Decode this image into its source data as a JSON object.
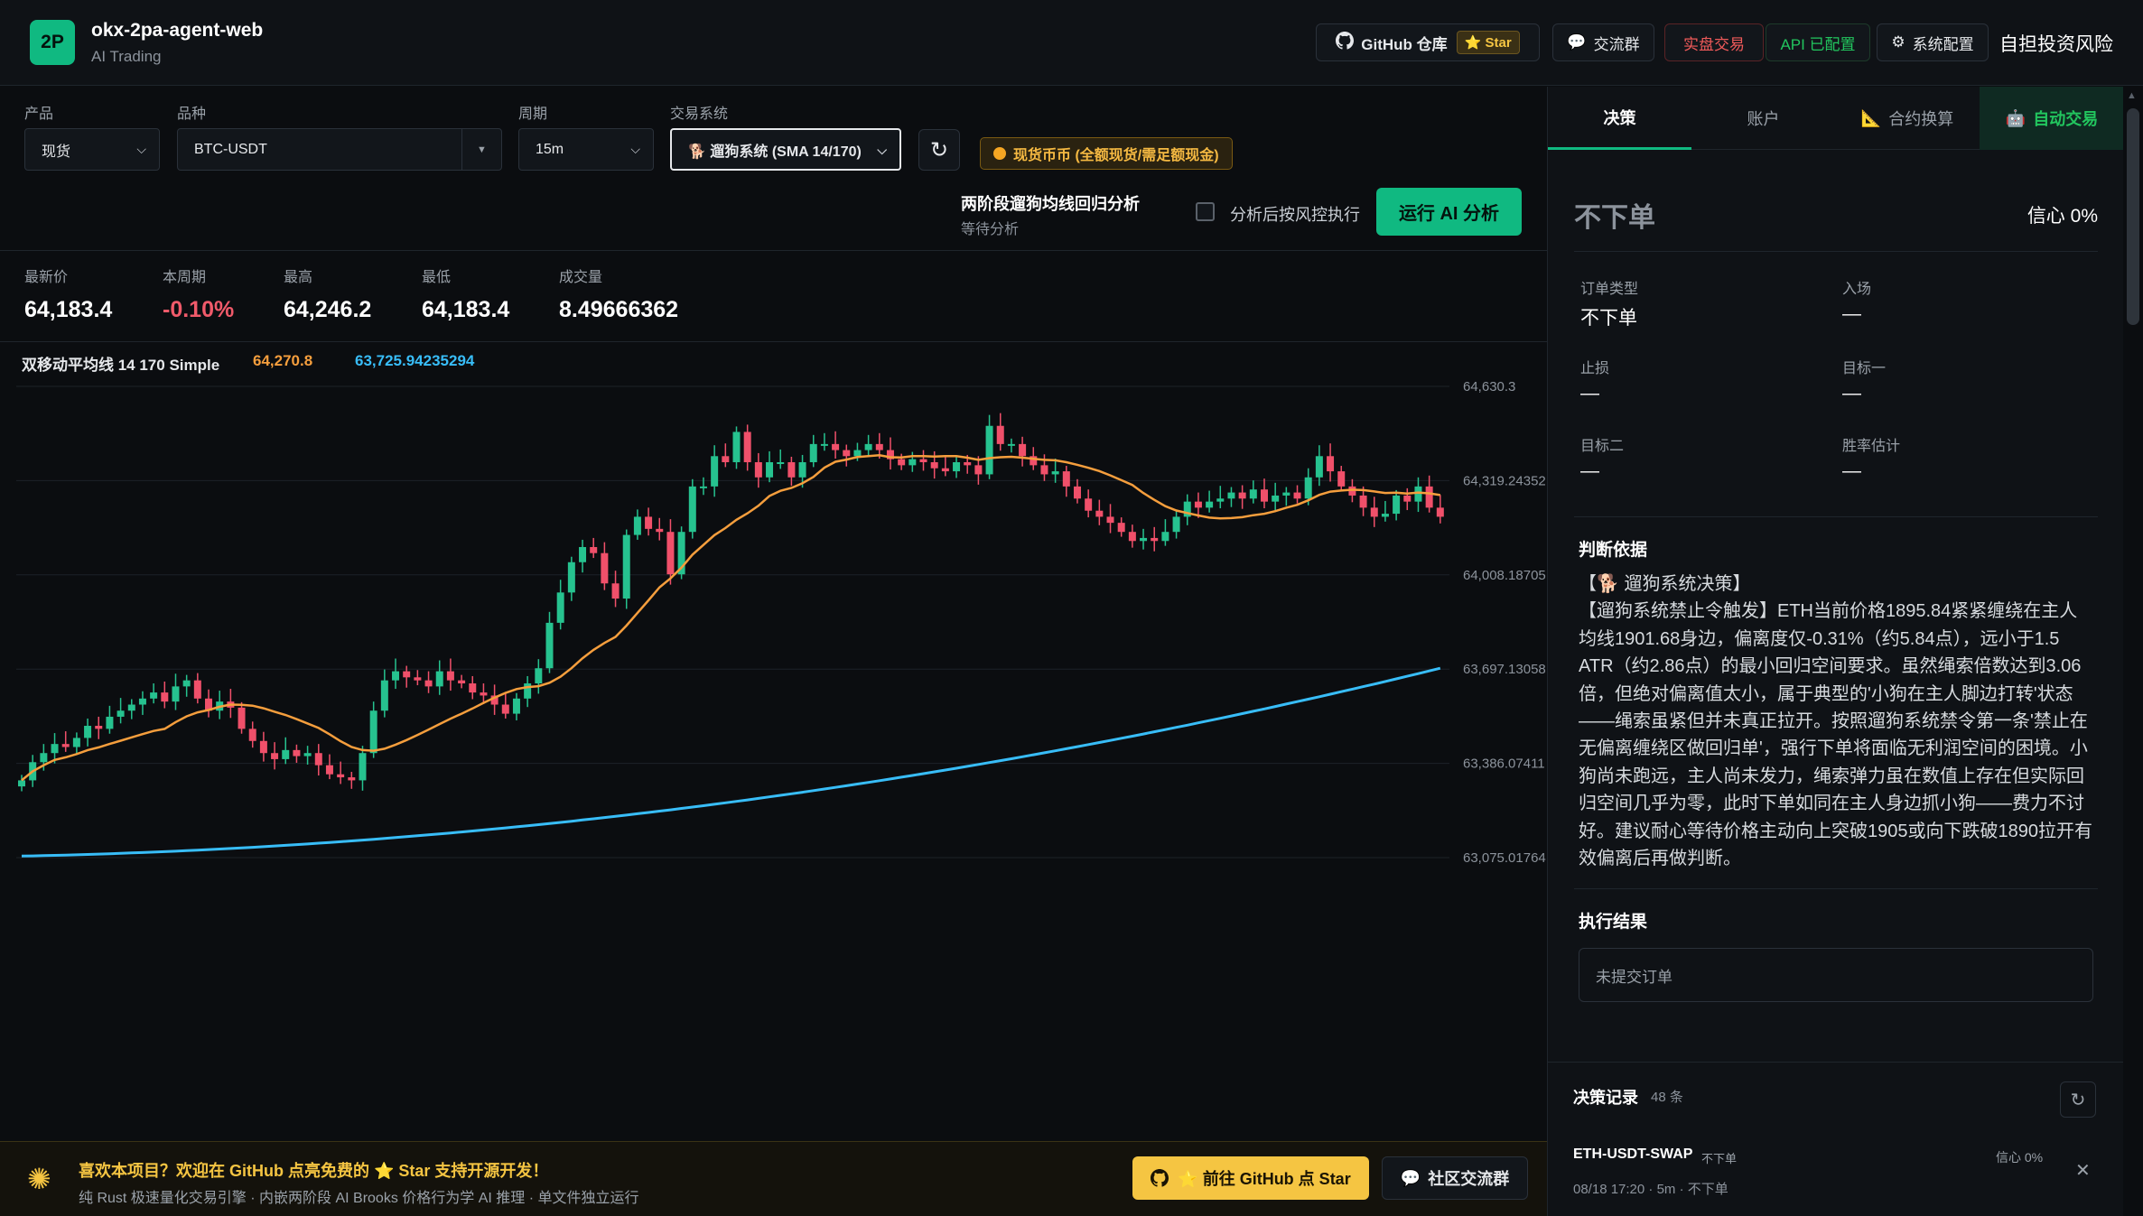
{
  "header": {
    "logo": "2P",
    "title": "okx-2pa-agent-web",
    "subtitle": "AI Trading",
    "github_label": "GitHub 仓库",
    "star_label": "Star",
    "chat_label": "交流群",
    "live_label": "实盘交易",
    "api_label": "API 已配置",
    "settings_label": "系统配置",
    "risk_notice": "自担投资风险"
  },
  "controls": {
    "product_label": "产品",
    "product_value": "现货",
    "symbol_label": "品种",
    "symbol_value": "BTC-USDT",
    "period_label": "周期",
    "period_value": "15m",
    "system_label": "交易系统",
    "system_value": "🐕 遛狗系统 (SMA 14/170)",
    "spot_badge": "现货币币 (全额现货/需足额现金)",
    "analysis_title": "两阶段遛狗均线回归分析",
    "analysis_status": "等待分析",
    "risk_exec_label": "分析后按风控执行",
    "run_button": "运行 AI 分析"
  },
  "stats": {
    "last_label": "最新价",
    "last_value": "64,183.4",
    "period_label": "本周期",
    "period_value": "-0.10%",
    "high_label": "最高",
    "high_value": "64,246.2",
    "low_label": "最低",
    "low_value": "64,183.4",
    "volume_label": "成交量",
    "volume_value": "8.49666362"
  },
  "chart_data": {
    "type": "candlestick",
    "indicator_name": "双移动平均线 14 170 Simple",
    "sma_fast_value": "64,270.8",
    "sma_slow_value": "63,725.94235294",
    "y_ticks": [
      "64,630.3",
      "64,319.24352",
      "64,008.18705",
      "63,697.13058",
      "63,386.07411",
      "63,075.01764"
    ],
    "ylim": [
      63075.02,
      64630.3
    ],
    "colors": {
      "up": "#26c28f",
      "down": "#f0506a",
      "sma_fast": "#f59e3d",
      "sma_slow": "#38bdf8"
    }
  },
  "banner": {
    "title": "喜欢本项目？欢迎在 GitHub 点亮免费的 ⭐ Star 支持开源开发！",
    "subtitle": "纯 Rust 极速量化交易引擎 · 内嵌两阶段 AI Brooks 价格行为学 AI 推理 · 单文件独立运行",
    "github_button": "⭐ 前往 GitHub 点 Star",
    "community_button": "社区交流群"
  },
  "panel": {
    "tabs": [
      "决策",
      "账户",
      "合约换算",
      "自动交易"
    ],
    "decision": "不下单",
    "confidence": "信心 0%",
    "fields": [
      {
        "label": "订单类型",
        "value": "不下单"
      },
      {
        "label": "入场",
        "value": "—"
      },
      {
        "label": "止损",
        "value": "—"
      },
      {
        "label": "目标一",
        "value": "—"
      },
      {
        "label": "目标二",
        "value": "—"
      },
      {
        "label": "胜率估计",
        "value": "—"
      }
    ],
    "reason_title": "判断依据",
    "reason_text": "【🐕 遛狗系统决策】\n【遛狗系统禁止令触发】ETH当前价格1895.84紧紧缠绕在主人均线1901.68身边，偏离度仅-0.31%（约5.84点），远小于1.5 ATR（约2.86点）的最小回归空间要求。虽然绳索倍数达到3.06倍，但绝对偏离值太小，属于典型的'小狗在主人脚边打转'状态——绳索虽紧但并未真正拉开。按照遛狗系统禁令第一条'禁止在无偏离缠绕区做回归单'，强行下单将面临无利润空间的困境。小狗尚未跑远，主人尚未发力，绳索弹力虽在数值上存在但实际回归空间几乎为零，此时下单如同在主人身边抓小狗——费力不讨好。建议耐心等待价格主动向上突破1905或向下跌破1890拉开有效偏离后再做判断。",
    "exec_title": "执行结果",
    "exec_value": "未提交订单",
    "history_title": "决策记录",
    "history_count": "48 条",
    "record": {
      "symbol": "ETH-USDT-SWAP",
      "action": "不下单",
      "confidence": "信心 0%",
      "meta": "08/18 17:20 · 5m · 不下单"
    }
  }
}
